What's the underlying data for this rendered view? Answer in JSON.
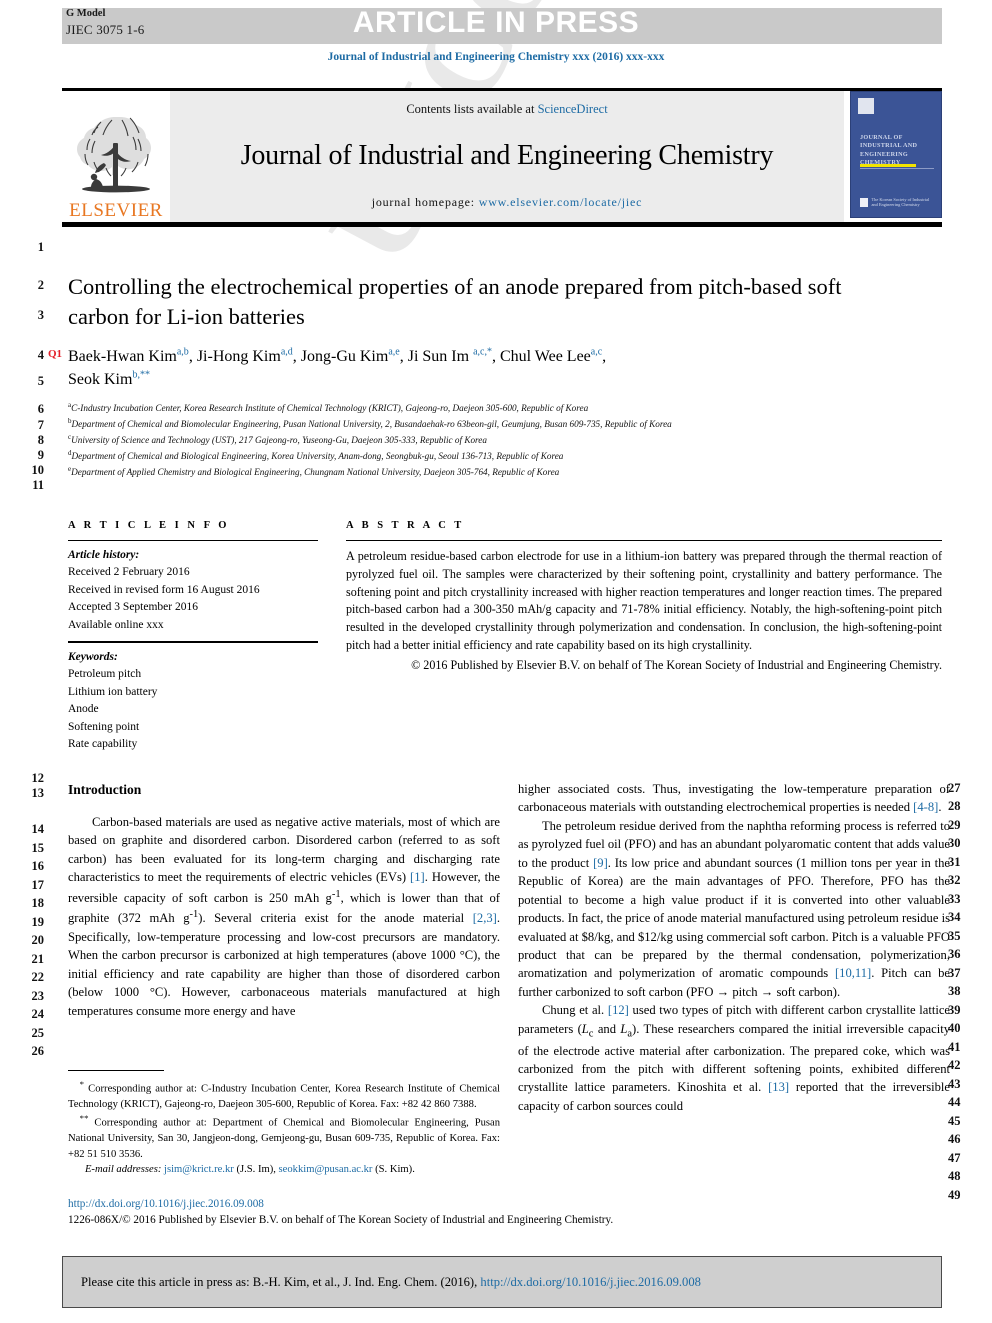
{
  "header": {
    "g_model_label": "G Model",
    "g_model_id": "JIEC 3075 1-6",
    "article_in_press": "ARTICLE IN PRESS",
    "running_head": "Journal of Industrial and Engineering Chemistry xxx (2016) xxx-xxx"
  },
  "masthead": {
    "contents_prefix": "Contents lists available at ",
    "contents_link": "ScienceDirect",
    "journal_name": "Journal of Industrial and Engineering Chemistry",
    "homepage_label": "journal homepage: ",
    "homepage_url": "www.elsevier.com/locate/jiec",
    "publisher_logo_text": "ELSEVIER",
    "cover_title": "Journal of Industrial and Engineering Chemistry",
    "cover_society": "The Korean Society of Industrial and Engineering Chemistry",
    "accent_blue": "#1d6ba4",
    "elsevier_orange": "#E87722",
    "cover_blue": "#3b5496"
  },
  "title_block": {
    "title": "Controlling the electrochemical properties of an anode prepared from pitch-based soft carbon for Li-ion batteries",
    "query_tag": "Q1",
    "authors_line1": "Baek-Hwan Kim",
    "authors": [
      {
        "name": "Baek-Hwan Kim",
        "sup": "a,b"
      },
      {
        "name": "Ji-Hong Kim",
        "sup": "a,d"
      },
      {
        "name": "Jong-Gu Kim",
        "sup": "a,e"
      },
      {
        "name": "Ji Sun Im",
        "sup": "a,c,*"
      },
      {
        "name": "Chul Wee Lee",
        "sup": "a,c"
      },
      {
        "name": "Seok Kim",
        "sup": "b,**"
      }
    ],
    "affiliations": [
      {
        "mark": "a",
        "text": "C-Industry Incubation Center, Korea Research Institute of Chemical Technology (KRICT), Gajeong-ro, Daejeon 305-600, Republic of Korea"
      },
      {
        "mark": "b",
        "text": "Department of Chemical and Biomolecular Engineering, Pusan National University, 2, Busandaehak-ro 63beon-gil, Geumjung, Busan 609-735, Republic of Korea"
      },
      {
        "mark": "c",
        "text": "University of Science and Technology (UST), 217 Gajeong-ro, Yuseong-Gu, Daejeon 305-333, Republic of Korea"
      },
      {
        "mark": "d",
        "text": "Department of Chemical and Biological Engineering, Korea University, Anam-dong, Seongbuk-gu, Seoul 136-713, Republic of Korea"
      },
      {
        "mark": "e",
        "text": "Department of Applied Chemistry and Biological Engineering, Chungnam National University, Daejeon 305-764, Republic of Korea"
      }
    ]
  },
  "article_info": {
    "heading": "A R T I C L E   I N F O",
    "history_label": "Article history:",
    "history": [
      "Received 2 February 2016",
      "Received in revised form 16 August 2016",
      "Accepted 3 September 2016",
      "Available online xxx"
    ],
    "keywords_label": "Keywords:",
    "keywords": [
      "Petroleum pitch",
      "Lithium ion battery",
      "Anode",
      "Softening point",
      "Rate capability"
    ]
  },
  "abstract": {
    "heading": "A B S T R A C T",
    "text": "A petroleum residue-based carbon electrode for use in a lithium-ion battery was prepared through the thermal reaction of pyrolyzed fuel oil. The samples were characterized by their softening point, crystallinity and battery performance. The softening point and pitch crystallinity increased with higher reaction temperatures and longer reaction times. The prepared pitch-based carbon had a 300-350 mAh/g capacity and 71-78% initial efficiency. Notably, the high-softening-point pitch resulted in the developed crystallinity through polymerization and condensation. In conclusion, the high-softening-point pitch had a better initial efficiency and rate capability based on its high crystallinity.",
    "copyright": "© 2016 Published by Elsevier B.V. on behalf of The Korean Society of Industrial and Engineering Chemistry."
  },
  "body": {
    "section_heading": "Introduction",
    "left_paragraph_1_a": "Carbon-based materials are used as negative active materials, most of which are based on graphite and disordered carbon. Disordered carbon (referred to as soft carbon) has been evaluated for its long-term charging and discharging rate characteristics to meet the requirements of electric vehicles (EVs) ",
    "left_ref_1": "[1]",
    "left_paragraph_1_b": ". However, the reversible capacity of soft carbon is 250 mAh g",
    "left_sup_1": "-1",
    "left_paragraph_1_c": ", which is lower than that of graphite (372 mAh g",
    "left_sup_2": "-1",
    "left_paragraph_1_d": "). Several criteria exist for the anode material ",
    "left_ref_2": "[2,3]",
    "left_paragraph_1_e": ". Specifically, low-temperature processing and low-cost precursors are mandatory. When the carbon precursor is carbonized at high temperatures (above 1000 °C), the initial efficiency and rate capability are higher than those of disordered carbon (below 1000 °C). However, carbonaceous materials manufactured at high temperatures consume more energy and have",
    "right_paragraph_1_a": "higher associated costs. Thus, investigating the low-temperature preparation of carbonaceous materials with outstanding electrochemical properties is needed ",
    "right_ref_1": "[4-8]",
    "right_paragraph_1_b": ".",
    "right_paragraph_2_a": "The petroleum residue derived from the naphtha reforming process is referred to as pyrolyzed fuel oil (PFO) and has an abundant polyaromatic content that adds value to the product ",
    "right_ref_2": "[9]",
    "right_paragraph_2_b": ". Its low price and abundant sources (1 million tons per year in the Republic of Korea) are the main advantages of PFO. Therefore, PFO has the potential to become a high value product if it is converted into other valuable products. In fact, the price of anode material manufactured using petroleum residue is evaluated at $8/kg, and $12/kg using commercial soft carbon. Pitch is a valuable PFO product that can be prepared by the thermal condensation, polymerization, aromatization and polymerization of aromatic compounds ",
    "right_ref_3": "[10,11]",
    "right_paragraph_2_c": ". Pitch can be further carbonized to soft carbon (PFO → pitch → soft carbon).",
    "right_paragraph_3_a": "Chung et al. ",
    "right_ref_4": "[12]",
    "right_paragraph_3_b": " used two types of pitch with different carbon crystallite lattice parameters (",
    "right_sym_lc": "L",
    "right_sym_lc_sub": "c",
    "right_paragraph_3_c": " and ",
    "right_sym_la": "L",
    "right_sym_la_sub": "a",
    "right_paragraph_3_d": "). These researchers compared the initial irreversible capacity of the electrode active material after carbonization. The prepared coke, which was carbonized from the pitch with different softening points, exhibited different crystallite lattice parameters. Kinoshita et al. ",
    "right_ref_5": "[13]",
    "right_paragraph_3_e": " reported that the irreversible capacity of carbon sources could"
  },
  "footnotes": {
    "fn1": "Corresponding author at: C-Industry Incubation Center, Korea Research Institute of Chemical Technology (KRICT), Gajeong-ro, Daejeon 305-600, Republic of Korea. Fax: +82 42 860 7388.",
    "fn1_mark": "*",
    "fn2": "Corresponding author at: Department of Chemical and Biomolecular Engineering, Pusan National University, San 30, Jangjeon-dong, Gemjeong-gu, Busan 609-735, Republic of Korea. Fax: +82 51 510 3536.",
    "fn2_mark": "**",
    "email_label": "E-mail addresses:",
    "email1": "jsim@krict.re.kr",
    "email1_owner": "(J.S. Im)",
    "email2": "seokkim@pusan.ac.kr",
    "email2_owner": "(S. Kim)"
  },
  "doi_block": {
    "doi_url": "http://dx.doi.org/10.1016/j.jiec.2016.09.008",
    "copyright": "1226-086X/© 2016 Published by Elsevier B.V. on behalf of The Korean Society of Industrial and Engineering Chemistry."
  },
  "cite_box": {
    "text": "Please cite this article in press as: B.-H. Kim, et al., J. Ind. Eng. Chem. (2016), ",
    "link": "http://dx.doi.org/10.1016/j.jiec.2016.09.008"
  },
  "line_numbers": {
    "left": [
      "1",
      "2",
      "3",
      "4",
      "5",
      "6",
      "7",
      "8",
      "9",
      "10",
      "11",
      "12",
      "13",
      "14",
      "15",
      "16",
      "17",
      "18",
      "19",
      "20",
      "21",
      "22",
      "23",
      "24",
      "25",
      "26"
    ],
    "right": [
      "27",
      "28",
      "29",
      "30",
      "31",
      "32",
      "33",
      "34",
      "35",
      "36",
      "37",
      "38",
      "39",
      "40",
      "41",
      "42",
      "43",
      "44",
      "45",
      "46",
      "47",
      "48",
      "49"
    ]
  },
  "watermark_text": "UNCORRECTED PROOF"
}
